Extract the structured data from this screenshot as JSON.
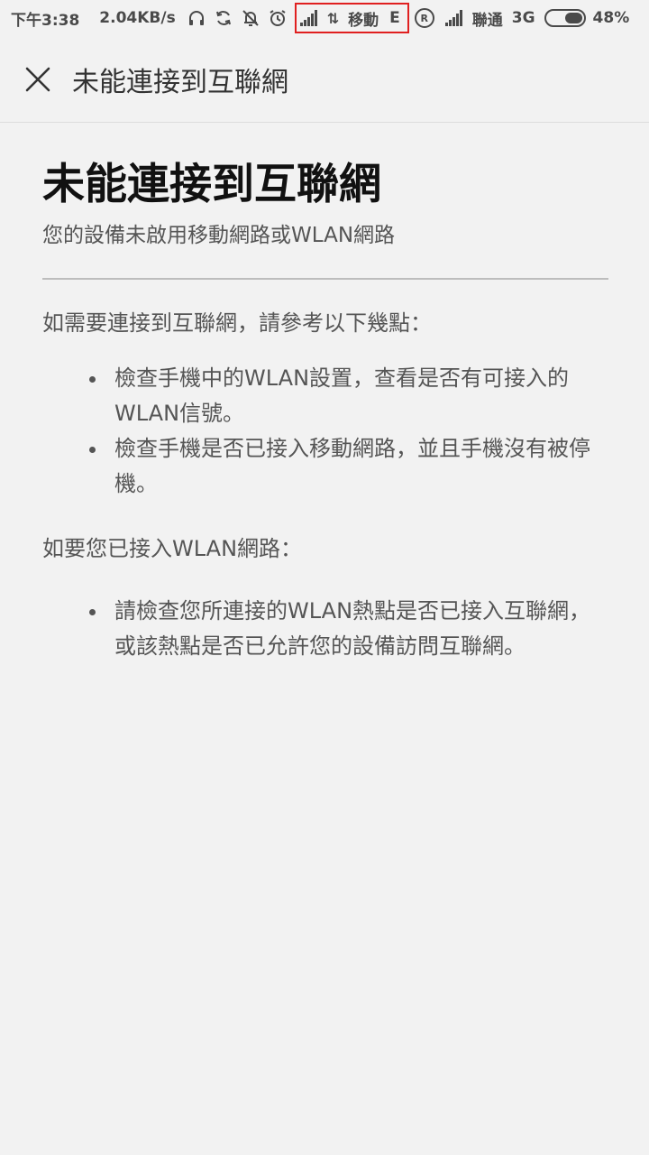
{
  "status_bar": {
    "time": "下午3:38",
    "speed": "2.04KB/s",
    "carrier1": "移動",
    "network1": "E",
    "registered": "R",
    "carrier2": "聯通",
    "network2": "3G",
    "battery": "48%",
    "battery_level": 0.48,
    "highlight_color": "#e02020",
    "icons": [
      "headset-icon",
      "sync-icon",
      "bell-off-icon",
      "alarm-icon",
      "signal-icon",
      "data-arrows-icon",
      "registered-icon",
      "battery-icon"
    ]
  },
  "app_bar": {
    "close_icon": "close-icon",
    "title": "未能連接到互聯網"
  },
  "main": {
    "heading": "未能連接到互聯網",
    "subtitle": "您的設備未啟用移動網路或WLAN網路",
    "section1_intro": "如需要連接到互聯網，請參考以下幾點：",
    "section1_items": [
      "檢查手機中的WLAN設置，查看是否有可接入的WLAN信號。",
      "檢查手機是否已接入移動網路，並且手機沒有被停機。"
    ],
    "section2_intro": "如要您已接入WLAN網路：",
    "section2_items": [
      "請檢查您所連接的WLAN熱點是否已接入互聯網，或該熱點是否已允許您的設備訪問互聯網。"
    ]
  }
}
